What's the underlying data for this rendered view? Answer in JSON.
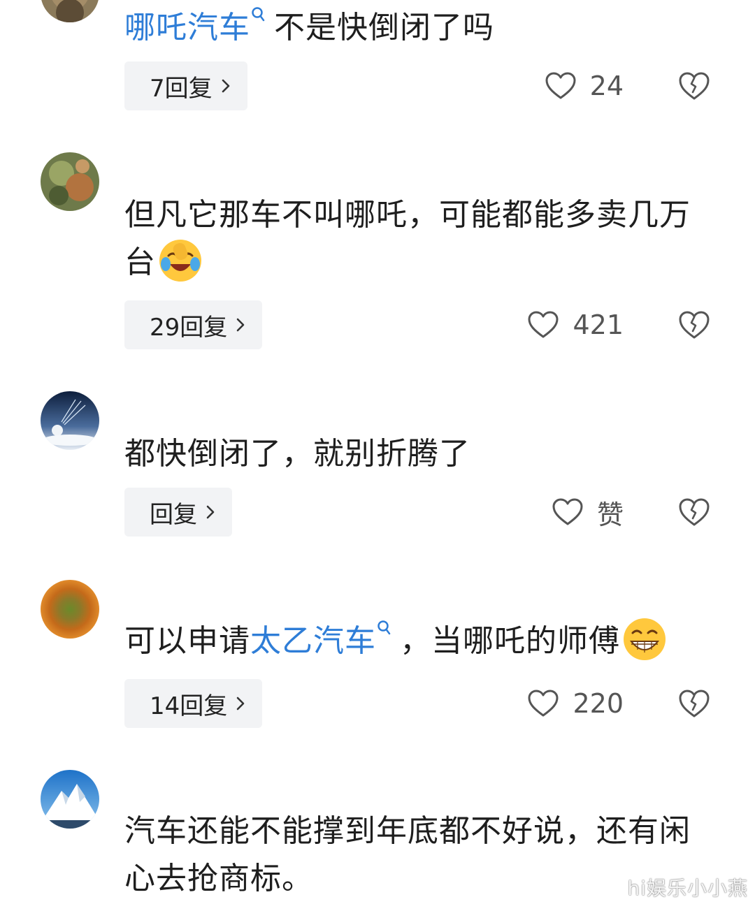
{
  "comments": [
    {
      "id": 1,
      "link_text": "哪吒汽车",
      "text": "不是快倒闭了吗",
      "reply_label": "7回复",
      "likes": "24"
    },
    {
      "id": 2,
      "text": "但凡它那车不叫哪吒，可能都能多卖几万台",
      "emoji": "laughing-crying-emoji",
      "reply_label": "29回复",
      "likes": "421"
    },
    {
      "id": 3,
      "text": "都快倒闭了，就别折腾了",
      "reply_label": "回复",
      "likes": "赞"
    },
    {
      "id": 4,
      "text_before": "可以申请",
      "link_text": "太乙汽车",
      "text_after": "，当哪吒的师傅",
      "emoji": "grinning-emoji",
      "reply_label": "14回复",
      "likes": "220"
    },
    {
      "id": 5,
      "text": "汽车还能不能撑到年底都不好说，还有闲心去抢商标。"
    }
  ],
  "watermark": "hi娱乐小小燕",
  "icons": {
    "like": "heart-outline-icon",
    "dislike": "broken-heart-icon",
    "reply_arrow": "chevron-right-icon",
    "link_search": "search-icon"
  },
  "colors": {
    "link": "#2e7dd7",
    "chip_bg": "#f2f3f5",
    "text": "#1e1e1e",
    "icon_gray": "#666666"
  }
}
